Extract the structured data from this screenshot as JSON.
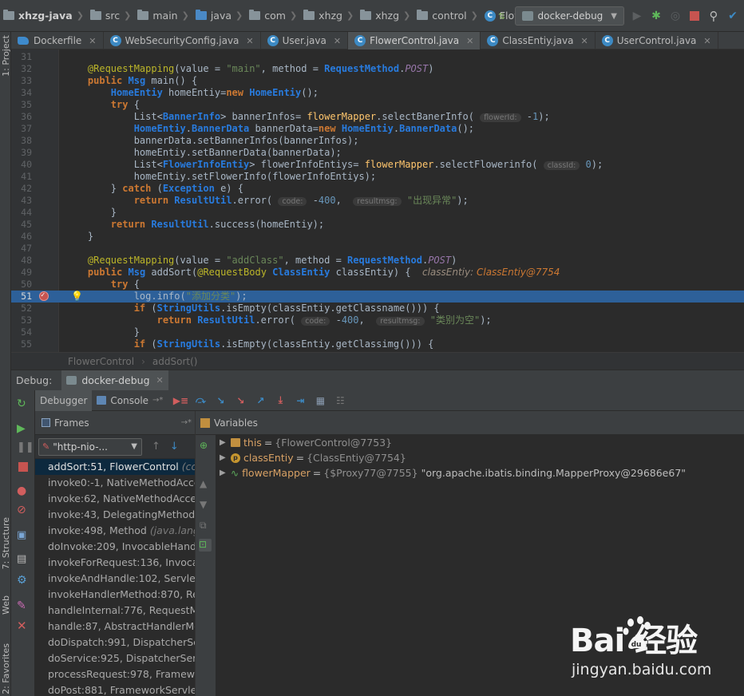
{
  "breadcrumb": {
    "project": "xhzg-java",
    "items": [
      "src",
      "main",
      "java",
      "com",
      "xhzg",
      "xhzg",
      "control"
    ],
    "file": "FlowerControl"
  },
  "toolbar": {
    "run_config": "docker-debug",
    "icons": [
      "sort-icon",
      "run-icon",
      "debug-icon",
      "profile-icon",
      "stop-icon",
      "search-icon",
      "vcs-icon"
    ]
  },
  "editor_tabs": [
    {
      "label": "Dockerfile",
      "icon": "docker-icon",
      "active": false
    },
    {
      "label": "WebSecurityConfig.java",
      "icon": "class-icon",
      "active": false
    },
    {
      "label": "User.java",
      "icon": "class-icon",
      "active": false
    },
    {
      "label": "FlowerControl.java",
      "icon": "class-icon",
      "active": true
    },
    {
      "label": "ClassEntiy.java",
      "icon": "class-icon",
      "active": false
    },
    {
      "label": "UserControl.java",
      "icon": "class-icon",
      "active": false
    }
  ],
  "left_strip": {
    "project": "1: Project",
    "structure": "7: Structure",
    "web": "Web",
    "favorites": "2: Favorites"
  },
  "code": {
    "first_line": 31,
    "lines": [
      "",
      "    @RequestMapping(value = \"main\", method = RequestMethod.POST)",
      "    public Msg main() {",
      "        HomeEntiy homeEntiy=new HomeEntiy();",
      "        try {",
      "            List<BannerInfo> bannerInfos= flowerMapper.selectBanerInfo( flowerId: -1);",
      "            HomeEntiy.BannerData bannerData=new HomeEntiy.BannerData();",
      "            bannerData.setBannerInfos(bannerInfos);",
      "            homeEntiy.setBannerData(bannerData);",
      "            List<FlowerInfoEntiy> flowerInfoEntiys= flowerMapper.selectFlowerinfo( classId: 0);",
      "            homeEntiy.setFlowerInfo(flowerInfoEntiys);",
      "        } catch (Exception e) {",
      "            return ResultUtil.error( code: -400,  resultmsg: \"出现异常\");",
      "        }",
      "        return ResultUtil.success(homeEntiy);",
      "    }",
      "",
      "    @RequestMapping(value = \"addClass\", method = RequestMethod.POST)",
      "    public Msg addSort(@RequestBody ClassEntiy classEntiy) {   classEntiy: ClassEntiy@7754",
      "        try {",
      "            log.info(\"添加分类\");",
      "            if (StringUtils.isEmpty(classEntiy.getClassname())) {",
      "                return ResultUtil.error( code: -400,  resultmsg: \"类别为空\");",
      "            }",
      "            if (StringUtils.isEmpty(classEntiy.getClassimg())) {"
    ],
    "breakpoint_line": 51,
    "current_line": 51,
    "hints": {
      "flowerId": "flowerId:",
      "classId": "classId:",
      "code": "code:",
      "resultmsg": "resultmsg:"
    }
  },
  "editor_breadcrumb": [
    "FlowerControl",
    "addSort()"
  ],
  "debug": {
    "label": "Debug:",
    "session": "docker-debug",
    "tabs": {
      "debugger": "Debugger",
      "console": "Console"
    },
    "frames_title": "Frames",
    "variables_title": "Variables",
    "thread": "\"http-nio-...",
    "frames": [
      {
        "method": "addSort:51, FlowerControl",
        "lib": "(co",
        "selected": true
      },
      {
        "method": "invoke0:-1, NativeMethodAcce",
        "lib": "",
        "selected": false
      },
      {
        "method": "invoke:62, NativeMethodAcce",
        "lib": "",
        "selected": false
      },
      {
        "method": "invoke:43, DelegatingMethodA",
        "lib": "",
        "selected": false
      },
      {
        "method": "invoke:498, Method",
        "lib": "(java.lang",
        "selected": false
      },
      {
        "method": "doInvoke:209, InvocableHand",
        "lib": "",
        "selected": false
      },
      {
        "method": "invokeForRequest:136, Invoca",
        "lib": "",
        "selected": false
      },
      {
        "method": "invokeAndHandle:102, Servlet",
        "lib": "",
        "selected": false
      },
      {
        "method": "invokeHandlerMethod:870, Re",
        "lib": "",
        "selected": false
      },
      {
        "method": "handleInternal:776, RequestM",
        "lib": "",
        "selected": false
      },
      {
        "method": "handle:87, AbstractHandlerMe",
        "lib": "",
        "selected": false
      },
      {
        "method": "doDispatch:991, DispatcherSe",
        "lib": "",
        "selected": false
      },
      {
        "method": "doService:925, DispatcherServ",
        "lib": "",
        "selected": false
      },
      {
        "method": "processRequest:978, Framewo",
        "lib": "",
        "selected": false
      },
      {
        "method": "doPost:881, FrameworkServle",
        "lib": "",
        "selected": false
      }
    ],
    "variables": [
      {
        "name": "this",
        "value": "{FlowerControl@7753}",
        "extra": "",
        "icon": "field-icon"
      },
      {
        "name": "classEntiy",
        "value": "{ClassEntiy@7754}",
        "extra": "",
        "icon": "parameter-icon"
      },
      {
        "name": "flowerMapper",
        "value": "{$Proxy77@7755}",
        "extra": "\"org.apache.ibatis.binding.MapperProxy@29686e67\"",
        "icon": "mapper-icon"
      }
    ]
  },
  "watermark": {
    "logo": "Bai  经验",
    "url": "jingyan.baidu.com"
  },
  "colors": {
    "accent": "#2d6099",
    "breakpoint": "#c75450",
    "keyword": "#cc7832",
    "string": "#6a8759",
    "number": "#6897bb"
  }
}
